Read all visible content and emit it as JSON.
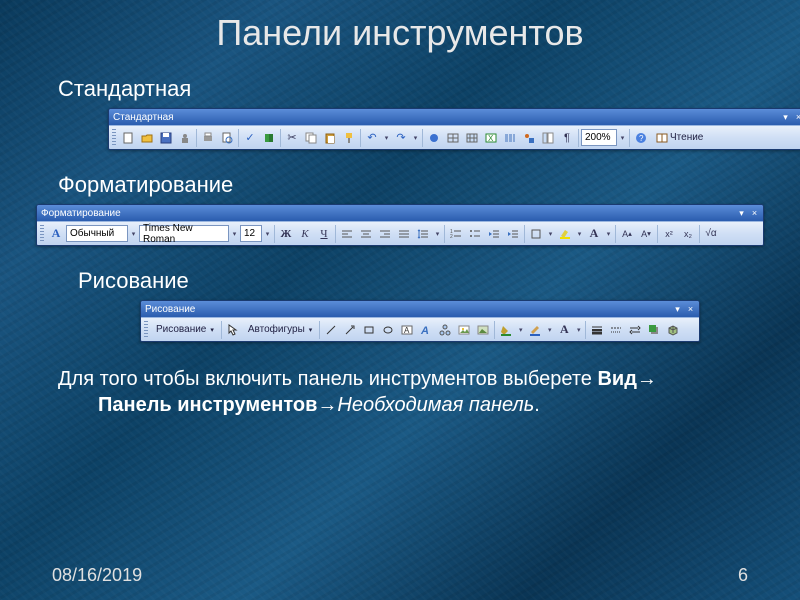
{
  "slide": {
    "title": "Панели инструментов",
    "sections": {
      "standard": "Стандартная",
      "formatting": "Форматирование",
      "drawing": "Рисование"
    },
    "body_prefix": "Для того чтобы включить панель инструментов выберете ",
    "body_bold1": "Вид",
    "arrow": "→",
    "body_bold2": "Панель инструментов",
    "body_ital": "Необходимая панель",
    "body_period": ".",
    "date": "08/16/2019",
    "page": "6"
  },
  "toolbars": {
    "standard": {
      "title": "Стандартная",
      "zoom": "200%",
      "read_btn": "Чтение"
    },
    "formatting": {
      "title": "Форматирование",
      "style": "Обычный",
      "font": "Times New Roman",
      "size": "12",
      "bold": "Ж",
      "italic": "К",
      "underline": "Ч",
      "A": "A"
    },
    "drawing": {
      "title": "Рисование",
      "draw_btn": "Рисование",
      "autoshapes": "Автофигуры"
    }
  },
  "glyphs": {
    "dropdown": "▾",
    "close": "×",
    "pilcrow": "¶",
    "undo": "↶",
    "redo": "↷",
    "cut": "✂",
    "help": "?",
    "book": "▭",
    "dot": "•"
  }
}
